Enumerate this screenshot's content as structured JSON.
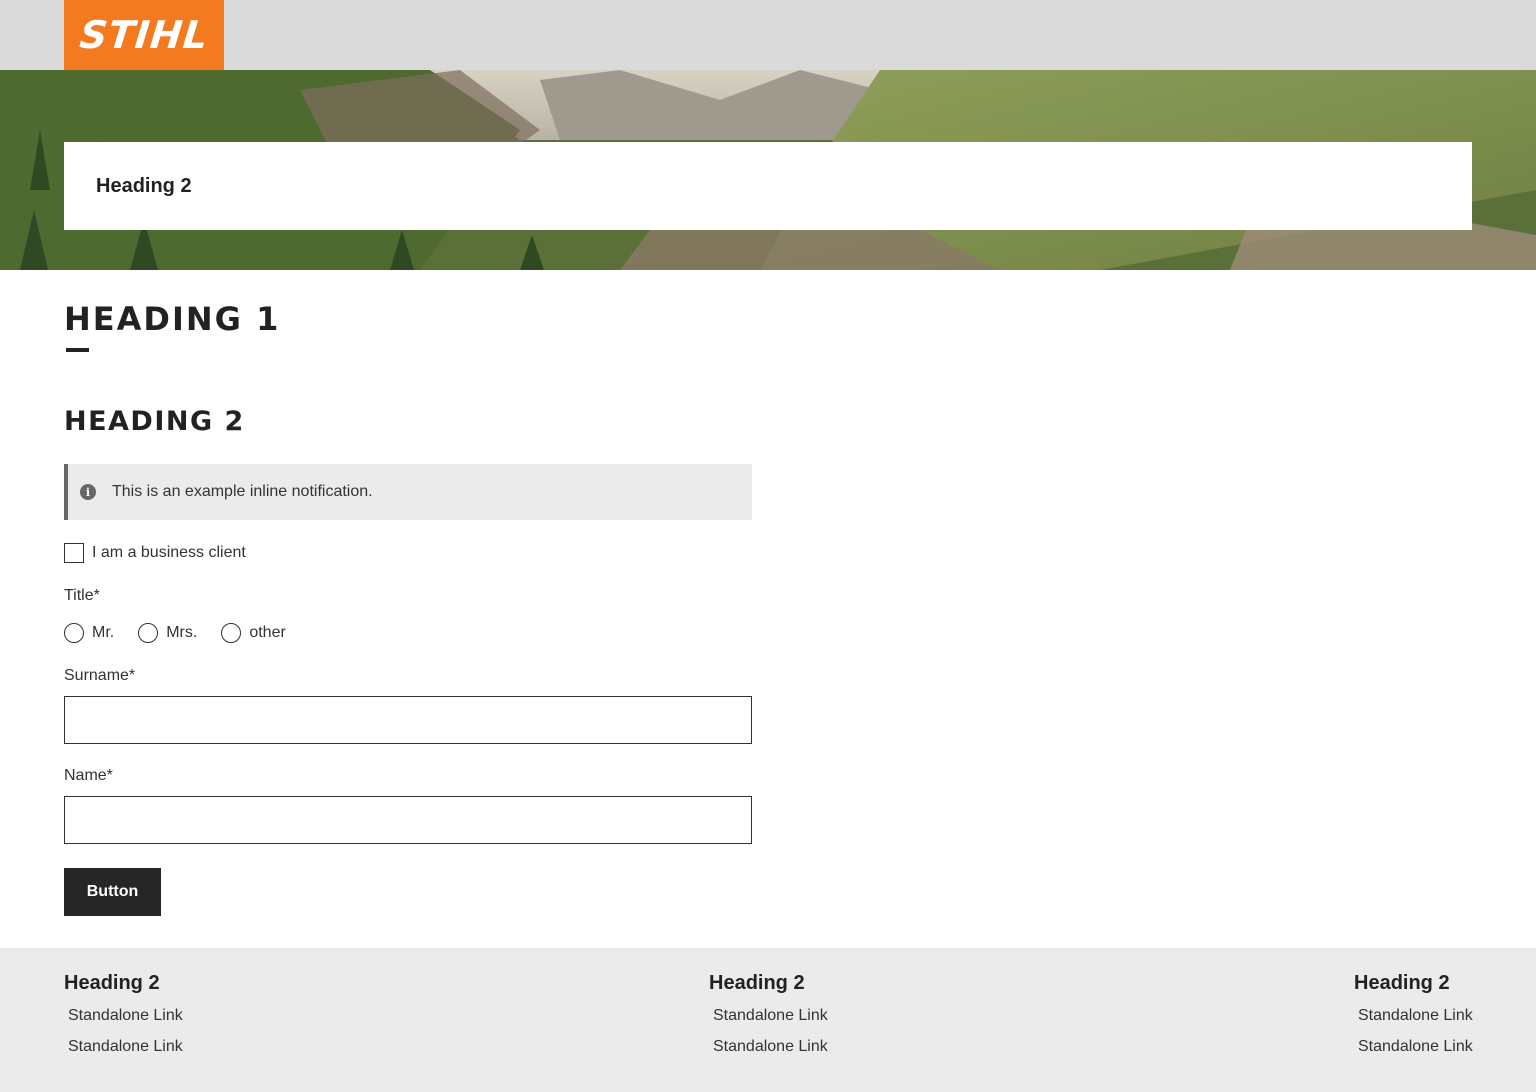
{
  "header": {
    "logo_text": "STIHL",
    "brand_color": "#f37a1f",
    "bar_color": "#dadada"
  },
  "hero": {
    "heading": "Heading 2"
  },
  "main": {
    "heading1": "Heading 1",
    "heading2": "Heading 2",
    "notification": {
      "icon": "info-icon",
      "text": "This is an example inline notification."
    },
    "business_checkbox": {
      "label": "I am a business client",
      "checked": false
    },
    "title_field": {
      "label": "Title*",
      "options": [
        "Mr.",
        "Mrs.",
        "other"
      ],
      "selected": null
    },
    "surname_field": {
      "label": "Surname*",
      "value": ""
    },
    "name_field": {
      "label": "Name*",
      "value": ""
    },
    "button_label": "Button"
  },
  "footer": {
    "columns": [
      {
        "heading": "Heading 2",
        "links": [
          "Standalone Link",
          "Standalone Link"
        ]
      },
      {
        "heading": "Heading 2",
        "links": [
          "Standalone Link",
          "Standalone Link"
        ]
      },
      {
        "heading": "Heading 2",
        "links": [
          "Standalone Link",
          "Standalone Link"
        ]
      }
    ]
  }
}
